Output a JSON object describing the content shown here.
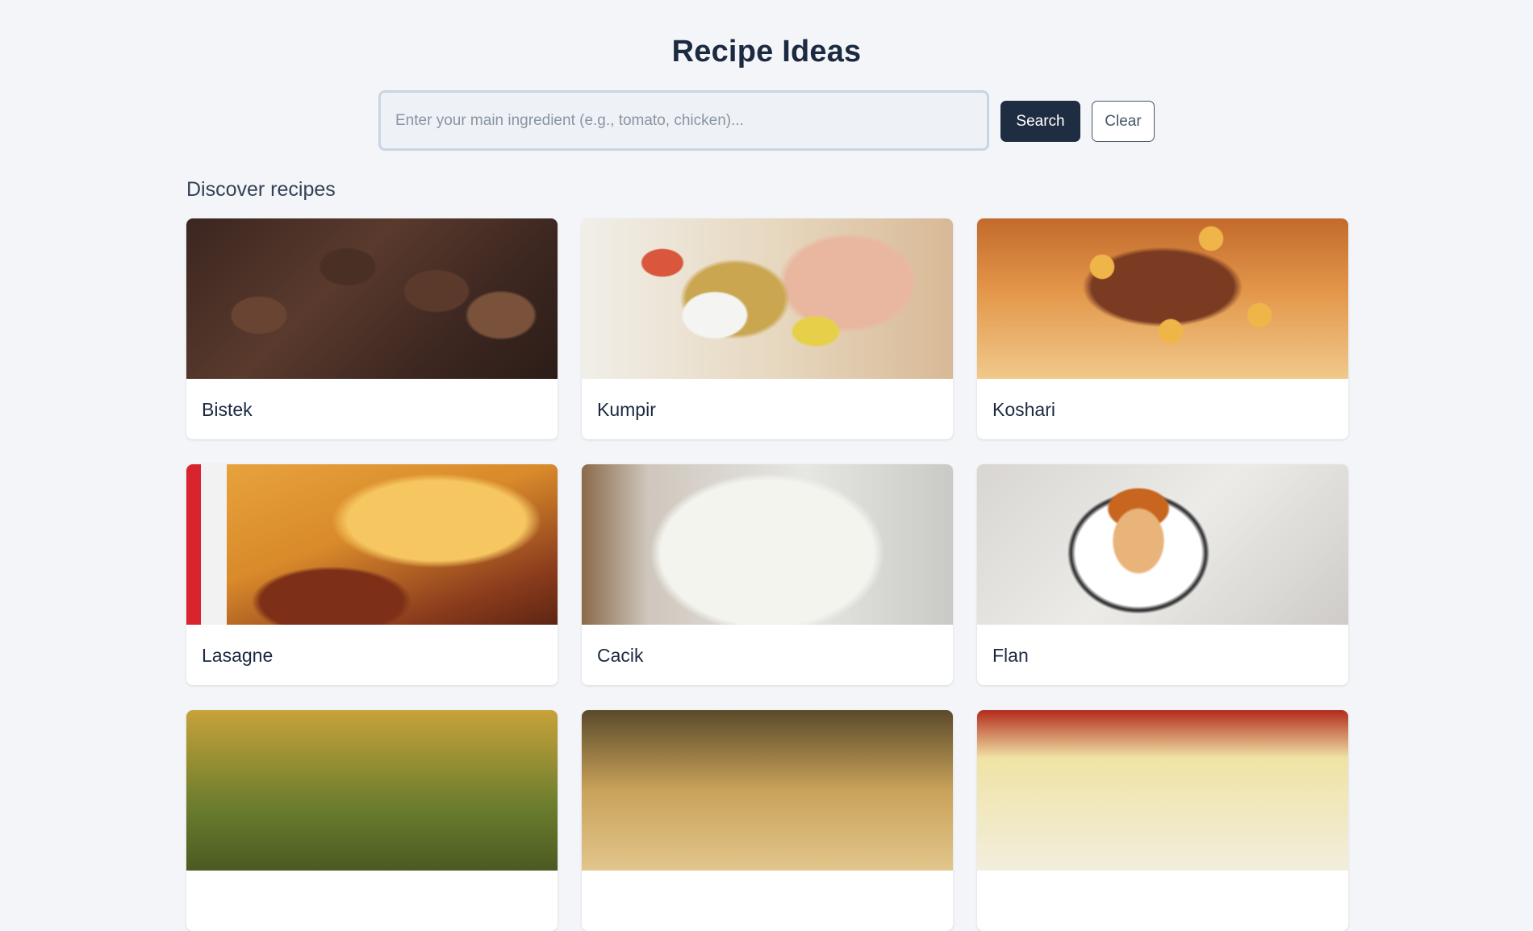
{
  "header": {
    "title": "Recipe Ideas"
  },
  "search": {
    "placeholder": "Enter your main ingredient (e.g., tomato, chicken)...",
    "value": "",
    "search_label": "Search",
    "clear_label": "Clear"
  },
  "main": {
    "section_title": "Discover recipes",
    "recipes": [
      {
        "title": "Bistek"
      },
      {
        "title": "Kumpir"
      },
      {
        "title": "Koshari"
      },
      {
        "title": "Lasagne"
      },
      {
        "title": "Cacik"
      },
      {
        "title": "Flan"
      },
      {
        "title": ""
      },
      {
        "title": ""
      },
      {
        "title": ""
      }
    ]
  },
  "colors": {
    "page_background": "#f3f5f8",
    "primary_button": "#1f2d42",
    "heading": "#1b2a41"
  }
}
